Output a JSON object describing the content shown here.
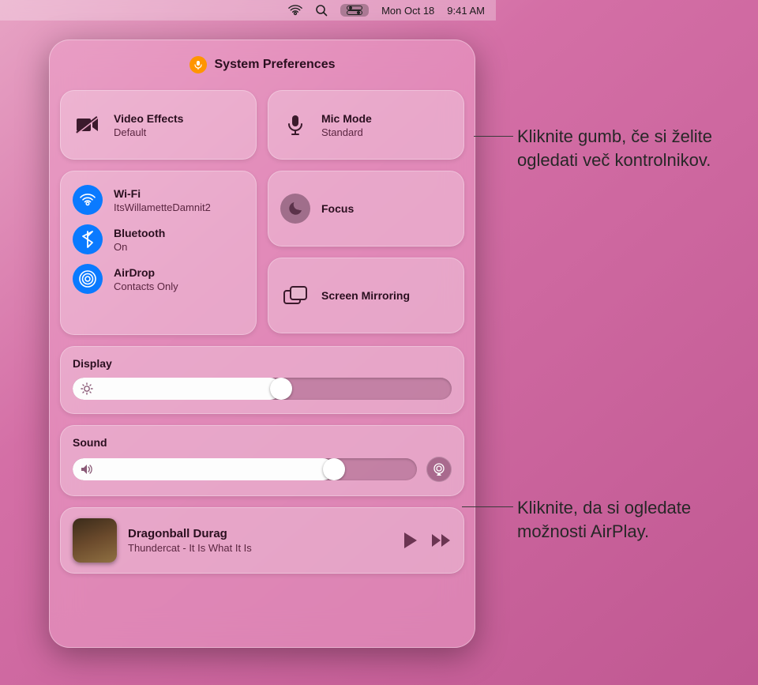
{
  "menubar": {
    "date": "Mon Oct 18",
    "time": "9:41 AM"
  },
  "header": {
    "app_name": "System Preferences",
    "mic_indicator": "microphone-icon"
  },
  "video_effects": {
    "title": "Video Effects",
    "subtitle": "Default",
    "icon": "camera-off-icon"
  },
  "mic_mode": {
    "title": "Mic Mode",
    "subtitle": "Standard",
    "icon": "microphone-icon"
  },
  "connectivity": {
    "wifi": {
      "title": "Wi-Fi",
      "subtitle": "ItsWillametteDamnit2",
      "icon": "wifi-icon"
    },
    "bluetooth": {
      "title": "Bluetooth",
      "subtitle": "On",
      "icon": "bluetooth-icon"
    },
    "airdrop": {
      "title": "AirDrop",
      "subtitle": "Contacts Only",
      "icon": "airdrop-icon"
    }
  },
  "focus": {
    "title": "Focus",
    "icon": "moon-icon"
  },
  "screen_mirroring": {
    "title": "Screen Mirroring",
    "icon": "screen-mirroring-icon"
  },
  "display": {
    "title": "Display",
    "brightness_percent": 55,
    "icon": "brightness-icon"
  },
  "sound": {
    "title": "Sound",
    "volume_percent": 68,
    "icon": "speaker-icon",
    "airplay_icon": "airplay-audio-icon"
  },
  "now_playing": {
    "track": "Dragonball Durag",
    "artist": "Thundercat - It Is What It Is",
    "play_icon": "play-icon",
    "next_icon": "forward-icon"
  },
  "callouts": {
    "c1": "Kliknite gumb, če si želite ogledati več kontrolnikov.",
    "c2": "Kliknite, da si ogledate možnosti AirPlay."
  },
  "colors": {
    "accent_blue": "#0a7aff",
    "accent_orange": "#ff9500"
  }
}
